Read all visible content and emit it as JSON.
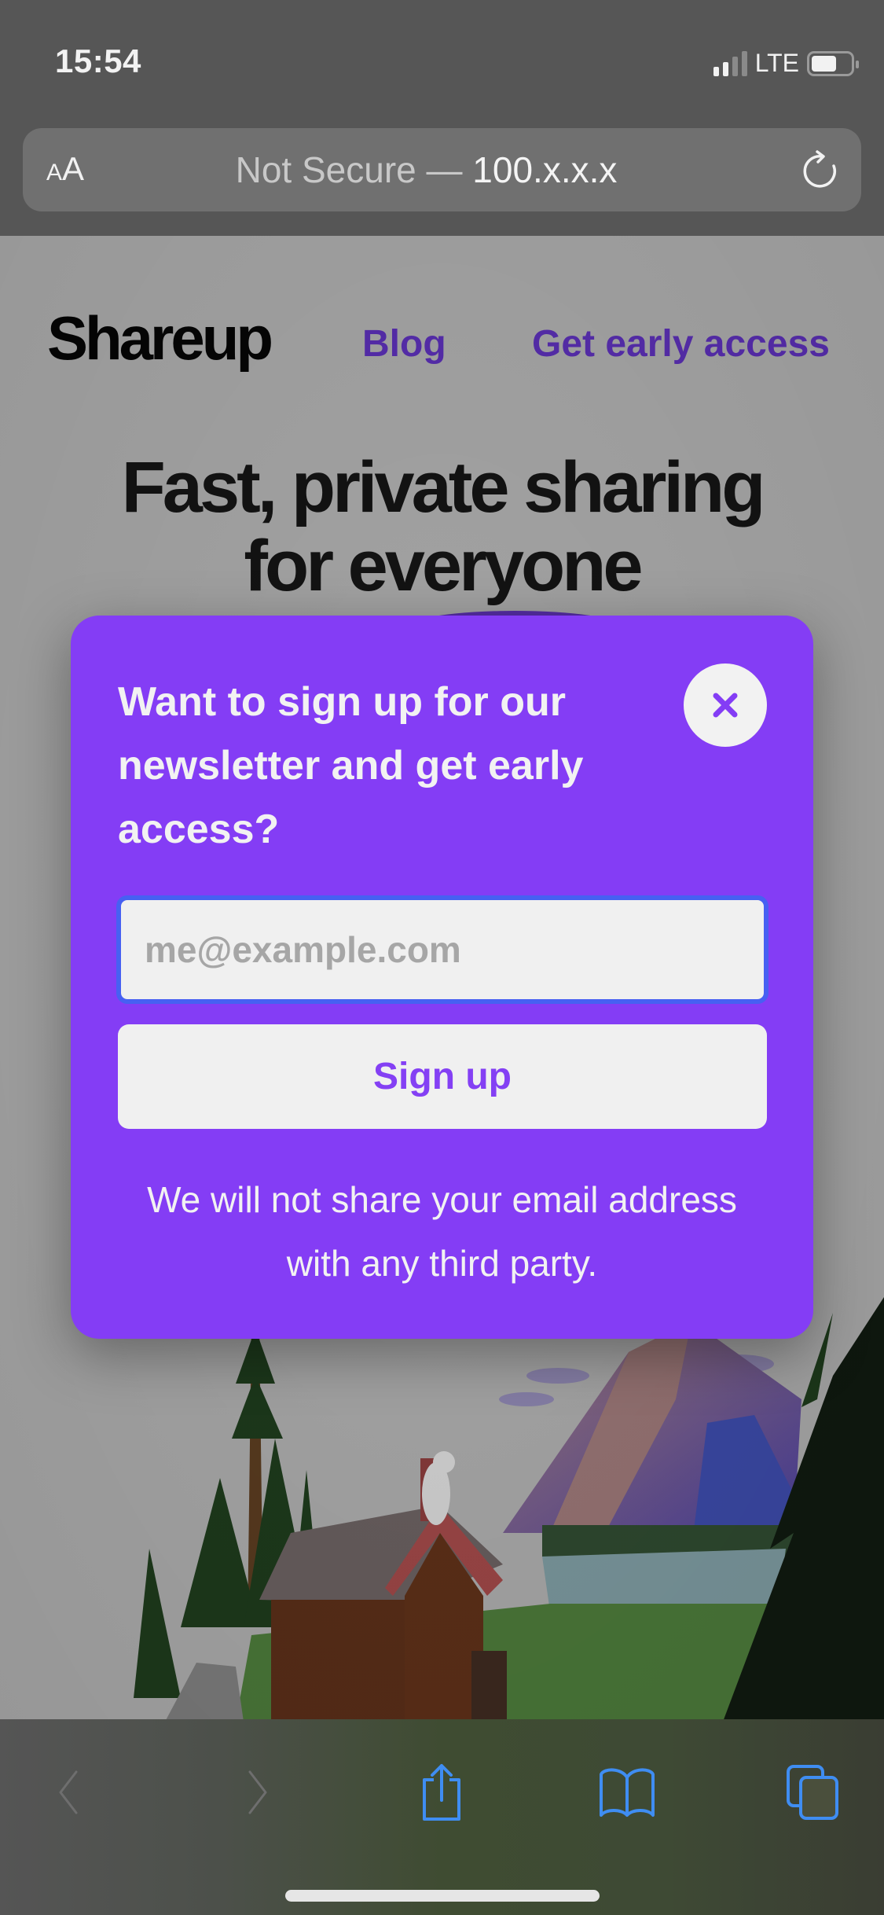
{
  "status_bar": {
    "time": "15:54",
    "network": "LTE",
    "signal_bars_active": 2,
    "signal_bars_total": 4,
    "battery_level": 0.65
  },
  "address_bar": {
    "text_size_label_small": "A",
    "text_size_label_large": "A",
    "security_label": "Not Secure —",
    "host": "100.x.x.x",
    "reload_icon": "reload-icon"
  },
  "site": {
    "logo": "Shareup",
    "nav": [
      {
        "label": "Blog"
      },
      {
        "label": "Get early access"
      }
    ],
    "hero_title_line1": "Fast, private sharing",
    "hero_title_line2": "for everyone",
    "accent_color": "#843df5",
    "link_color": "#5a2fb4"
  },
  "modal": {
    "title": "Want to sign up for our newsletter and get early access?",
    "close_icon": "close-icon",
    "email_placeholder": "me@example.com",
    "email_value": "",
    "signup_label": "Sign up",
    "disclaimer": "We will not share your email address with any third party.",
    "focus_ring_color": "#4760f2"
  },
  "toolbar": {
    "items": [
      {
        "name": "back",
        "icon": "chevron-left-icon",
        "enabled": false
      },
      {
        "name": "forward",
        "icon": "chevron-right-icon",
        "enabled": false
      },
      {
        "name": "share",
        "icon": "share-icon",
        "enabled": true
      },
      {
        "name": "bookmarks",
        "icon": "book-icon",
        "enabled": true
      },
      {
        "name": "tabs",
        "icon": "tabs-icon",
        "enabled": true
      }
    ],
    "icon_color": "#3f8df2"
  }
}
